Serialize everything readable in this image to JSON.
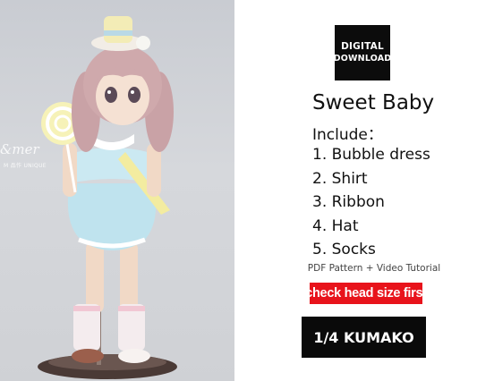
{
  "watermark": {
    "main": "&mer",
    "sub": "M 品作 UNIQUE"
  },
  "badge": {
    "line1": "DIGITAL",
    "line2": "DOWNLOAD"
  },
  "product": {
    "title": "Sweet Baby",
    "include_label": "Include：",
    "items": [
      "1. Bubble dress",
      "2. Shirt",
      "3. Ribbon",
      "4. Hat",
      "5. Socks"
    ]
  },
  "format_note": "PDF Pattern + Video Tutorial",
  "warning": "check head size first",
  "doll_size": "1/4 KUMAKO",
  "colors": {
    "warning_bg": "#e8131b",
    "badge_bg": "#0c0c0c",
    "dress": "#bfe3ee"
  }
}
